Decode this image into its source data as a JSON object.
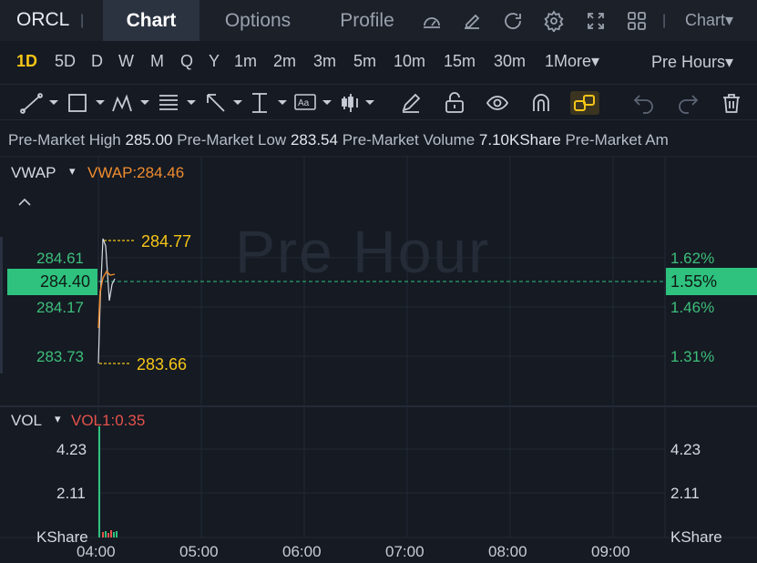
{
  "header": {
    "ticker": "ORCL",
    "separator": "|",
    "tabs": [
      {
        "label": "Chart",
        "active": true
      },
      {
        "label": "Options",
        "active": false
      },
      {
        "label": "Profile",
        "active": false
      }
    ],
    "icons": [
      "gauge-icon",
      "edit-icon",
      "refresh-icon",
      "settings-icon",
      "fullscreen-icon",
      "grid-icon"
    ],
    "chart_menu": "Chart▾"
  },
  "intervals": {
    "items": [
      "1D",
      "5D",
      "D",
      "W",
      "M",
      "Q",
      "Y",
      "1m",
      "2m",
      "3m",
      "5m",
      "10m",
      "15m",
      "30m",
      "1More▾"
    ],
    "active": "1D",
    "session": "Pre Hours▾"
  },
  "toolbar": {
    "tools": [
      "line-tool-icon",
      "rectangle-tool-icon",
      "pattern-tool-icon",
      "fib-tool-icon",
      "arrow-tool-icon",
      "measure-tool-icon",
      "text-tool-icon",
      "indicator-tool-icon",
      "pencil-icon",
      "unlock-icon",
      "eye-icon",
      "magnet-icon",
      "link-icon",
      "undo-icon",
      "redo-icon",
      "trash-icon"
    ],
    "active_tool": "link-icon"
  },
  "info": {
    "high_label": "Pre-Market High",
    "high_value": "285.00",
    "low_label": "Pre-Market Low",
    "low_value": "283.54",
    "volume_label": "Pre-Market Volume",
    "volume_value": "7.10KShare",
    "amount_label": "Pre-Market Am"
  },
  "price_panel": {
    "indicator": "VWAP",
    "indicator_arrow": "▾",
    "indicator_value": "VWAP:284.46",
    "collapse_icon": "chevron-up-icon",
    "watermark": "Pre Hour",
    "left_axis": [
      "284.61",
      "284.17",
      "283.73"
    ],
    "right_axis": [
      "1.62%",
      "1.46%",
      "1.31%"
    ],
    "current_price": "284.40",
    "current_pct": "1.55%",
    "high_marker": "284.77",
    "low_marker": "283.66"
  },
  "volume_panel": {
    "indicator": "VOL",
    "indicator_arrow": "▾",
    "indicator_value": "VOL1:0.35",
    "left_axis": [
      "4.23",
      "2.11",
      "KShare"
    ],
    "right_axis": [
      "4.23",
      "2.11",
      "KShare"
    ]
  },
  "time_axis": [
    "04:00",
    "05:00",
    "06:00",
    "07:00",
    "08:00",
    "09:00"
  ],
  "colors": {
    "accent": "#f5c518",
    "up": "#2ec27e",
    "vwap": "#f08c2e",
    "vol_label": "#e5534b",
    "background": "#151a23"
  }
}
